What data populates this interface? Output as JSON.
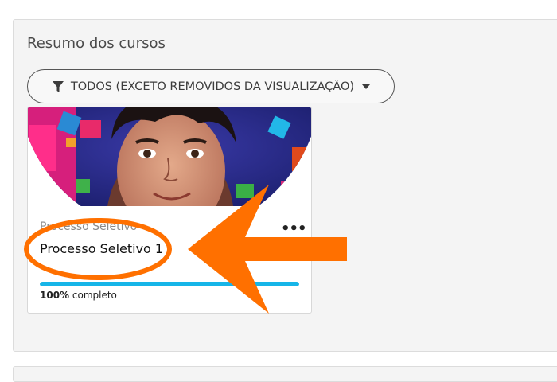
{
  "block": {
    "title": "Resumo dos cursos",
    "filter_label": "TODOS (EXCETO REMOVIDOS DA VISUALIZAÇÃO)"
  },
  "course": {
    "category": "Processo Seletivo",
    "name": "Processo Seletivo 1",
    "progress_percent": 100,
    "progress_value": "100%",
    "progress_suffix": " completo",
    "menu_label": "•••"
  },
  "icons": {
    "filter": "filter-icon",
    "caret": "caret-down-icon",
    "menu": "more-options-icon"
  },
  "colors": {
    "progress": "#16b5e8",
    "annotation": "#ff7000"
  }
}
